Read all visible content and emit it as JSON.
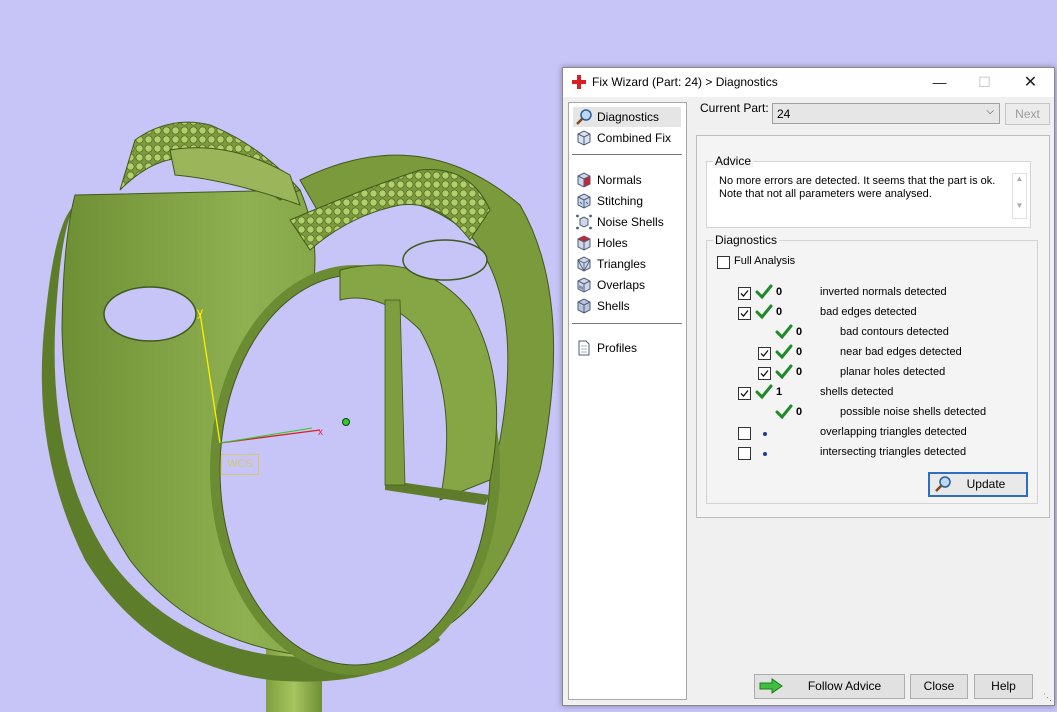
{
  "viewport": {
    "wcs_label": "WCS",
    "y_axis_label": "y",
    "x_axis_label": "x"
  },
  "dialog": {
    "title": "Fix Wizard (Part: 24) > Diagnostics",
    "controls": {
      "minimize": "—",
      "maximize": "☐",
      "close": "✕"
    },
    "nav": {
      "items": [
        {
          "label": "Diagnostics",
          "icon": "magnifier-icon"
        },
        {
          "label": "Combined Fix",
          "icon": "cube-icon"
        },
        {
          "label": "Normals",
          "icon": "normals-cube-icon"
        },
        {
          "label": "Stitching",
          "icon": "stitching-cube-icon"
        },
        {
          "label": "Noise Shells",
          "icon": "noise-shells-icon"
        },
        {
          "label": "Holes",
          "icon": "holes-cube-icon"
        },
        {
          "label": "Triangles",
          "icon": "triangles-cube-icon"
        },
        {
          "label": "Overlaps",
          "icon": "overlaps-cube-icon"
        },
        {
          "label": "Shells",
          "icon": "shells-cube-icon"
        },
        {
          "label": "Profiles",
          "icon": "document-icon"
        }
      ]
    },
    "current_part": {
      "label": "Current Part:",
      "value": "24"
    },
    "next_label": "Next",
    "advice": {
      "title": "Advice",
      "text": "No more errors are detected. It seems that the part is ok.\nNote that not all parameters were analysed."
    },
    "diagnostics": {
      "title": "Diagnostics",
      "full_analysis_label": "Full Analysis",
      "full_analysis_checked": false,
      "rows": [
        {
          "checked": true,
          "status": "ok",
          "value": "0",
          "label": "inverted normals detected"
        },
        {
          "checked": true,
          "status": "ok",
          "value": "0",
          "label": "bad edges detected"
        },
        {
          "checked": null,
          "status": "ok",
          "value": "0",
          "label": "bad contours detected"
        },
        {
          "checked": true,
          "status": "ok",
          "value": "0",
          "label": "near bad edges detected"
        },
        {
          "checked": true,
          "status": "ok",
          "value": "0",
          "label": "planar holes detected"
        },
        {
          "checked": true,
          "status": "ok",
          "value": "1",
          "label": "shells detected"
        },
        {
          "checked": null,
          "status": "ok",
          "value": "0",
          "label": "possible noise shells detected"
        },
        {
          "checked": false,
          "status": "dot",
          "value": "",
          "label": "overlapping triangles detected"
        },
        {
          "checked": false,
          "status": "dot",
          "value": "",
          "label": "intersecting triangles detected"
        }
      ],
      "update_label": "Update"
    },
    "buttons": {
      "follow_advice": "Follow Advice",
      "close": "Close",
      "help": "Help"
    }
  }
}
